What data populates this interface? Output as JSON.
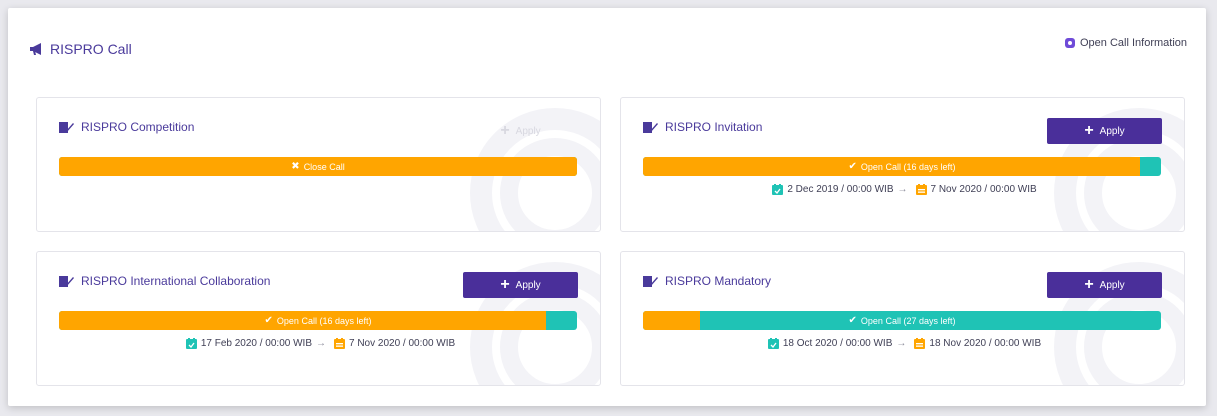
{
  "header": {
    "title": "RISPRO Call",
    "info_link": "Open Call Information"
  },
  "icons": {
    "header": "megaphone-icon",
    "card": "edit-note-icon",
    "start": "calendar-check-icon",
    "end": "calendar-end-icon",
    "arrow": "arrow-right-icon",
    "plus": "plus-icon"
  },
  "colors": {
    "brand": "#4a2f9a",
    "orange": "#ffa500",
    "teal": "#1fc3b5"
  },
  "cards": [
    {
      "title": "RISPRO Competition",
      "apply": "Apply",
      "apply_enabled": false,
      "status": "Close Call",
      "status_icon": "✖",
      "elapsed": 1.0,
      "start": "",
      "end": ""
    },
    {
      "title": "RISPRO Invitation",
      "apply": "Apply",
      "apply_enabled": true,
      "status": "Open Call (16 days left)",
      "status_icon": "✔",
      "elapsed": 0.96,
      "start": "2 Dec 2019 / 00:00 WIB",
      "end": "7 Nov 2020 / 00:00 WIB"
    },
    {
      "title": "RISPRO International Collaboration",
      "apply": "Apply",
      "apply_enabled": true,
      "status": "Open Call (16 days left)",
      "status_icon": "✔",
      "elapsed": 0.94,
      "start": "17 Feb 2020 / 00:00 WIB",
      "end": "7 Nov 2020 / 00:00 WIB"
    },
    {
      "title": "RISPRO Mandatory",
      "apply": "Apply",
      "apply_enabled": true,
      "status": "Open Call (27 days left)",
      "status_icon": "✔",
      "elapsed": 0.11,
      "start": "18 Oct 2020 / 00:00 WIB",
      "end": "18 Nov 2020 / 00:00 WIB"
    }
  ]
}
